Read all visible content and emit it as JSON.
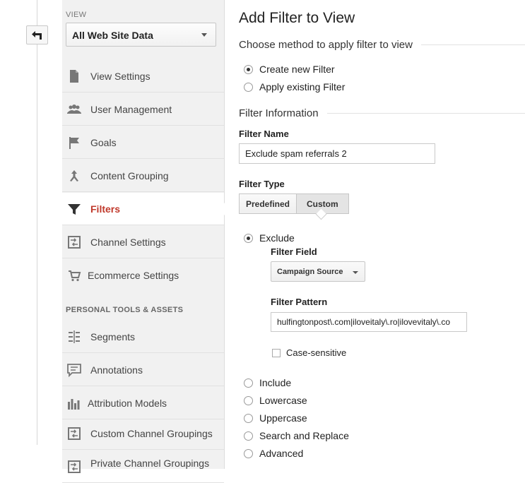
{
  "sidebar": {
    "view_label": "VIEW",
    "view_selected": "All Web Site Data",
    "items": [
      {
        "label": "View Settings",
        "icon": "document-icon"
      },
      {
        "label": "User Management",
        "icon": "users-icon"
      },
      {
        "label": "Goals",
        "icon": "flag-icon"
      },
      {
        "label": "Content Grouping",
        "icon": "merge-icon"
      },
      {
        "label": "Filters",
        "icon": "funnel-icon",
        "active": true
      },
      {
        "label": "Channel Settings",
        "icon": "channel-icon"
      },
      {
        "label": "Ecommerce Settings",
        "icon": "cart-icon"
      }
    ],
    "section_heading": "PERSONAL TOOLS & ASSETS",
    "tools": [
      {
        "label": "Segments",
        "icon": "segments-icon"
      },
      {
        "label": "Annotations",
        "icon": "annotation-icon"
      },
      {
        "label": "Attribution Models",
        "icon": "bar-chart-icon"
      },
      {
        "label": "Custom Channel Groupings",
        "icon": "channel-icon"
      },
      {
        "label": "Private Channel Groupings",
        "icon": "channel-icon"
      }
    ]
  },
  "main": {
    "title": "Add Filter to View",
    "method_legend": "Choose method to apply filter to view",
    "method_options": [
      {
        "label": "Create new Filter",
        "selected": true
      },
      {
        "label": "Apply existing Filter",
        "selected": false
      }
    ],
    "info_legend": "Filter Information",
    "filter_name_label": "Filter Name",
    "filter_name_value": "Exclude spam referrals 2",
    "filter_type_label": "Filter Type",
    "filter_type_tabs": [
      {
        "label": "Predefined",
        "selected": false
      },
      {
        "label": "Custom",
        "selected": true
      }
    ],
    "custom_options": [
      {
        "label": "Exclude",
        "selected": true
      },
      {
        "label": "Include",
        "selected": false
      },
      {
        "label": "Lowercase",
        "selected": false
      },
      {
        "label": "Uppercase",
        "selected": false
      },
      {
        "label": "Search and Replace",
        "selected": false
      },
      {
        "label": "Advanced",
        "selected": false
      }
    ],
    "filter_field_label": "Filter Field",
    "filter_field_value": "Campaign Source",
    "filter_pattern_label": "Filter Pattern",
    "filter_pattern_value": "hulfingtonpost\\.com|iloveitaly\\.ro|ilovevitaly\\.co",
    "case_sensitive_label": "Case-sensitive"
  },
  "colors": {
    "active_nav": "#c0392b",
    "sidebar_bg": "#f1f1f1"
  }
}
